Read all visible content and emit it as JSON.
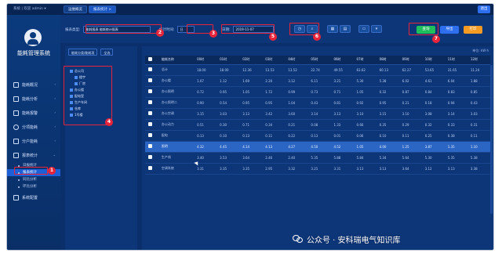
{
  "topbar": {
    "user_line": "系统 | 欢迎 admin ▾",
    "tabs": [
      {
        "label": "运维概览"
      },
      {
        "label": "报表统计 ×"
      }
    ],
    "exit_label": "退出"
  },
  "sidebar": {
    "system_name": "能耗管理系统",
    "items": [
      {
        "label": "能耗概况",
        "icon": "monitor-icon"
      },
      {
        "label": "能耗分析",
        "icon": "chart-icon"
      },
      {
        "label": "能耗报警",
        "icon": "alarm-icon"
      },
      {
        "label": "分项能耗",
        "icon": "clock-icon"
      },
      {
        "label": "分户能耗",
        "icon": "building-icon"
      },
      {
        "label": "报表统计",
        "icon": "report-icon"
      }
    ],
    "sub_items": [
      {
        "label": "日报统计",
        "selected": false
      },
      {
        "label": "报表统计",
        "selected": true
      },
      {
        "label": "同比分析",
        "selected": false
      },
      {
        "label": "环比分析",
        "selected": false
      }
    ],
    "bottom_item": {
      "label": "系统配置",
      "icon": "settings-icon"
    }
  },
  "toolbar": {
    "report_type_label": "报表类型:",
    "report_type_value": "能耗报表 能耗统计报表",
    "time_type_label": "统计时间:",
    "time_type_value": "日",
    "date_label": "日期:",
    "date_value": "2019-11-07",
    "export_label": "导出",
    "print_label": "打印",
    "query_label": "查询"
  },
  "tree": {
    "tabs": [
      "能耗分类/能耗项",
      "全选"
    ],
    "nodes": [
      {
        "label": "总公司",
        "level": 0
      },
      {
        "label": "楼宇",
        "level": 1
      },
      {
        "label": "厂房",
        "level": 1
      },
      {
        "label": "办公楼",
        "level": 0
      },
      {
        "label": "配电室",
        "level": 0
      },
      {
        "label": "生产车间",
        "level": 0
      },
      {
        "label": "仓库",
        "level": 0
      },
      {
        "label": "1号楼",
        "level": 0
      }
    ]
  },
  "table": {
    "unit": "单位: kW·h",
    "headers": [
      "",
      "能耗名称",
      "00时",
      "01时",
      "02时",
      "03时",
      "04时",
      "05时",
      "06时",
      "07时",
      "08时",
      "09时",
      "10时",
      "11时",
      "12时"
    ],
    "rows": [
      {
        "cells": [
          "总计",
          "18.00",
          "18.00",
          "12.36",
          "13.53",
          "13.52",
          "22.74",
          "49.55",
          "63.62",
          "60.13",
          "62.27",
          "53.65",
          "31.65",
          "11.24",
          "23.38"
        ],
        "hl": false
      },
      {
        "cells": [
          "办公楼",
          "1.07",
          "1.12",
          "1.69",
          "2.20",
          "3.12",
          "6.11",
          "3.21",
          "5.30",
          "5.38",
          "6.02",
          "4.61",
          "6.04",
          "1.88",
          "1.05"
        ],
        "hl": false
      },
      {
        "cells": [
          "办公照明",
          "0.72",
          "0.95",
          "1.05",
          "1.72",
          "0.99",
          "0.73",
          "0.71",
          "1.05",
          "0.32",
          "0.87",
          "0.84",
          "0.83",
          "0.85",
          "0.15"
        ],
        "hl": false
      },
      {
        "cells": [
          "办公照明二",
          "0.90",
          "0.54",
          "0.95",
          "0.95",
          "1.04",
          "0.43",
          "0.81",
          "0.92",
          "0.95",
          "0.21",
          "0.18",
          "0.94",
          "0.43",
          "0.41"
        ],
        "hl": false
      },
      {
        "cells": [
          "办公空调",
          "3.15",
          "3.03",
          "3.13",
          "3.42",
          "3.60",
          "3.14",
          "3.13",
          "3.10",
          "3.15",
          "3.10",
          "3.08",
          "3.14",
          "3.03",
          "3.16"
        ],
        "hl": false
      },
      {
        "cells": [
          "办公动力",
          "0.51",
          "0.30",
          "0.71",
          "0.34",
          "0.21",
          "0.08",
          "1.33",
          "0.66",
          "0.35",
          "0.29",
          "0.32",
          "0.33",
          "0.31",
          "0.22"
        ],
        "hl": false
      },
      {
        "cells": [
          "配电",
          "0.13",
          "0.10",
          "0.13",
          "0.11",
          "0.22",
          "0.13",
          "0.01",
          "0.06",
          "0.10",
          "0.11",
          "0.25",
          "0.38",
          "0.11",
          "0.17"
        ],
        "hl": false
      },
      {
        "cells": [
          "照明",
          "4.32",
          "4.45",
          "4.14",
          "4.13",
          "4.27",
          "4.50",
          "4.52",
          "1.05",
          "4.00",
          "1.25",
          "3.87",
          "1.35",
          "1.10",
          "1.50"
        ],
        "hl": true
      },
      {
        "cells": [
          "生产线",
          "3.40",
          "3.53",
          "3.64",
          "2.46",
          "2.40",
          "5.35",
          "5.88",
          "5.84",
          "5.34",
          "5.64",
          "5.30",
          "5.35",
          "5.38",
          "5.33"
        ],
        "hl": false
      },
      {
        "cells": [
          "空调系统",
          "3.31",
          "3.35",
          "3.35",
          "2.95",
          "3.32",
          "3.21",
          "3.31",
          "3.13",
          "3.13",
          "3.64",
          "3.12",
          "3.13",
          "3.38",
          "3.38"
        ],
        "hl": false
      }
    ]
  },
  "annotations": [
    "1",
    "2",
    "3",
    "4",
    "5",
    "6",
    "7"
  ],
  "watermark": {
    "text": "公众号 · 安科瑞电气知识库"
  },
  "colors": {
    "annotation_red": "#e8243a",
    "accent_green": "#1fbf5b",
    "accent_orange": "#f59a23",
    "accent_blue": "#2e6ff0"
  }
}
